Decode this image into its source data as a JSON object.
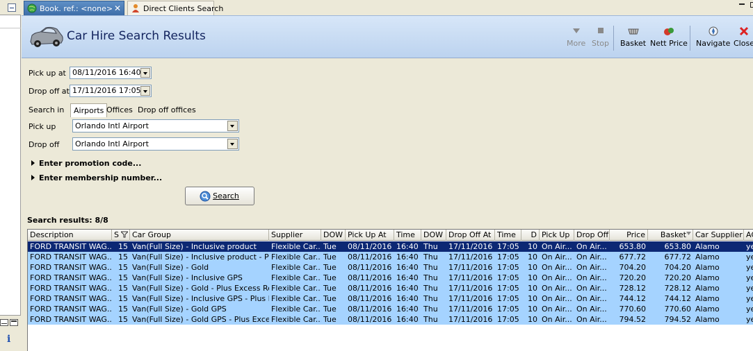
{
  "tabs": [
    {
      "label": "Book. ref.: <none>",
      "active": true,
      "close": "✕"
    },
    {
      "label": "Direct Clients Search",
      "active": false
    }
  ],
  "header": {
    "title": "Car Hire Search Results"
  },
  "toolbar": {
    "more": "More",
    "stop": "Stop",
    "basket": "Basket",
    "nett_price": "Nett Price",
    "navigate": "Navigate",
    "close": "Close"
  },
  "form": {
    "pickup_at_label": "Pick up at",
    "pickup_at_value": "08/11/2016 16:40",
    "dropoff_at_label": "Drop off at",
    "dropoff_at_value": "17/11/2016 17:05",
    "search_in_label": "Search in",
    "search_in_options": [
      "Airports",
      "Offices",
      "Drop off offices"
    ],
    "search_in_selected": "Airports",
    "pickup_label": "Pick up",
    "pickup_value": "Orlando Intl Airport",
    "dropoff_label": "Drop off",
    "dropoff_value": "Orlando Intl Airport",
    "promo_label": "Enter promotion code...",
    "membership_label": "Enter membership number...",
    "search_button": "Search"
  },
  "results": {
    "label": "Search results: 8/8",
    "columns": [
      "Description",
      "S",
      "Car Group",
      "Supplier",
      "DOW",
      "Pick Up At",
      "Time",
      "DOW",
      "Drop Off At",
      "Time",
      "D",
      "Pick Up",
      "Drop Off",
      "Price",
      "Basket",
      "Car Supplier",
      "AC"
    ],
    "rows": [
      [
        "FORD TRANSIT WAG...",
        "15",
        "Van(Full Size) - Inclusive product",
        "Flexible Car...",
        "Tue",
        "08/11/2016",
        "16:40",
        "Thu",
        "17/11/2016",
        "17:05",
        "10",
        "On Air...",
        "On Air...",
        "653.80",
        "653.80",
        "Alamo",
        "ye"
      ],
      [
        "FORD TRANSIT WAG...",
        "15",
        "Van(Full Size) - Inclusive product - Plu...",
        "Flexible Car...",
        "Tue",
        "08/11/2016",
        "16:40",
        "Thu",
        "17/11/2016",
        "17:05",
        "10",
        "On Air...",
        "On Air...",
        "677.72",
        "677.72",
        "Alamo",
        "ye"
      ],
      [
        "FORD TRANSIT WAG...",
        "15",
        "Van(Full Size) - Gold",
        "Flexible Car...",
        "Tue",
        "08/11/2016",
        "16:40",
        "Thu",
        "17/11/2016",
        "17:05",
        "10",
        "On Air...",
        "On Air...",
        "704.20",
        "704.20",
        "Alamo",
        "ye"
      ],
      [
        "FORD TRANSIT WAG...",
        "15",
        "Van(Full Size) - Inclusive GPS",
        "Flexible Car...",
        "Tue",
        "08/11/2016",
        "16:40",
        "Thu",
        "17/11/2016",
        "17:05",
        "10",
        "On Air...",
        "On Air...",
        "720.20",
        "720.20",
        "Alamo",
        "ye"
      ],
      [
        "FORD TRANSIT WAG...",
        "15",
        "Van(Full Size) - Gold - Plus Excess Ref...",
        "Flexible Car...",
        "Tue",
        "08/11/2016",
        "16:40",
        "Thu",
        "17/11/2016",
        "17:05",
        "10",
        "On Air...",
        "On Air...",
        "728.12",
        "728.12",
        "Alamo",
        "ye"
      ],
      [
        "FORD TRANSIT WAG...",
        "15",
        "Van(Full Size) - Inclusive GPS - Plus Ex...",
        "Flexible Car...",
        "Tue",
        "08/11/2016",
        "16:40",
        "Thu",
        "17/11/2016",
        "17:05",
        "10",
        "On Air...",
        "On Air...",
        "744.12",
        "744.12",
        "Alamo",
        "ye"
      ],
      [
        "FORD TRANSIT WAG...",
        "15",
        "Van(Full Size) - Gold GPS",
        "Flexible Car...",
        "Tue",
        "08/11/2016",
        "16:40",
        "Thu",
        "17/11/2016",
        "17:05",
        "10",
        "On Air...",
        "On Air...",
        "770.60",
        "770.60",
        "Alamo",
        "ye"
      ],
      [
        "FORD TRANSIT WAG...",
        "15",
        "Van(Full Size) - Gold GPS - Plus Excess...",
        "Flexible Car...",
        "Tue",
        "08/11/2016",
        "16:40",
        "Thu",
        "17/11/2016",
        "17:05",
        "10",
        "On Air...",
        "On Air...",
        "794.52",
        "794.52",
        "Alamo",
        "ye"
      ]
    ],
    "selected_row": 0
  },
  "side": {
    "info_glyph": "i"
  },
  "colors": {
    "selected_row": "#0c2874",
    "row_bg": "#a5d3ff",
    "header_bg": "#c9dcf3",
    "title": "#13245e"
  }
}
